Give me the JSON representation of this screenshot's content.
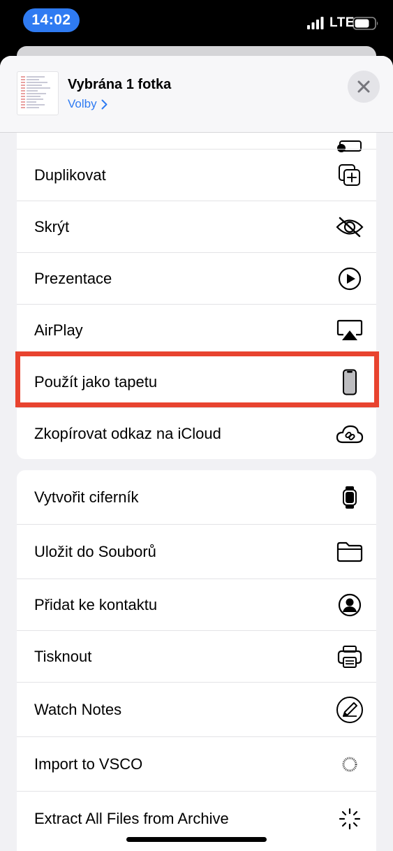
{
  "status_bar": {
    "time": "14:02",
    "network": "LTE"
  },
  "header": {
    "title": "Vybrána 1 fotka",
    "options_label": "Volby"
  },
  "group1": {
    "items": [
      {
        "label": "Duplikovat",
        "icon": "duplicate-icon"
      },
      {
        "label": "Skrýt",
        "icon": "eye-slash-icon"
      },
      {
        "label": "Prezentace",
        "icon": "play-circle-icon"
      },
      {
        "label": "AirPlay",
        "icon": "airplay-icon"
      },
      {
        "label": "Použít jako tapetu",
        "icon": "iphone-icon"
      },
      {
        "label": "Zkopírovat odkaz na iCloud",
        "icon": "cloud-link-icon"
      }
    ]
  },
  "group2": {
    "items": [
      {
        "label": "Vytvořit ciferník",
        "icon": "watch-icon"
      },
      {
        "label": "Uložit do Souborů",
        "icon": "folder-icon"
      },
      {
        "label": "Přidat ke kontaktu",
        "icon": "person-circle-icon"
      },
      {
        "label": "Tisknout",
        "icon": "printer-icon"
      },
      {
        "label": "Watch Notes",
        "icon": "pen-circle-icon"
      },
      {
        "label": "Import to VSCO",
        "icon": "vsco-icon"
      },
      {
        "label": "Extract All Files from Archive",
        "icon": "spinner-icon"
      }
    ]
  },
  "colors": {
    "accent": "#2f7bf2",
    "highlight": "#e8432f",
    "sheet_bg": "#f1f1f4"
  }
}
